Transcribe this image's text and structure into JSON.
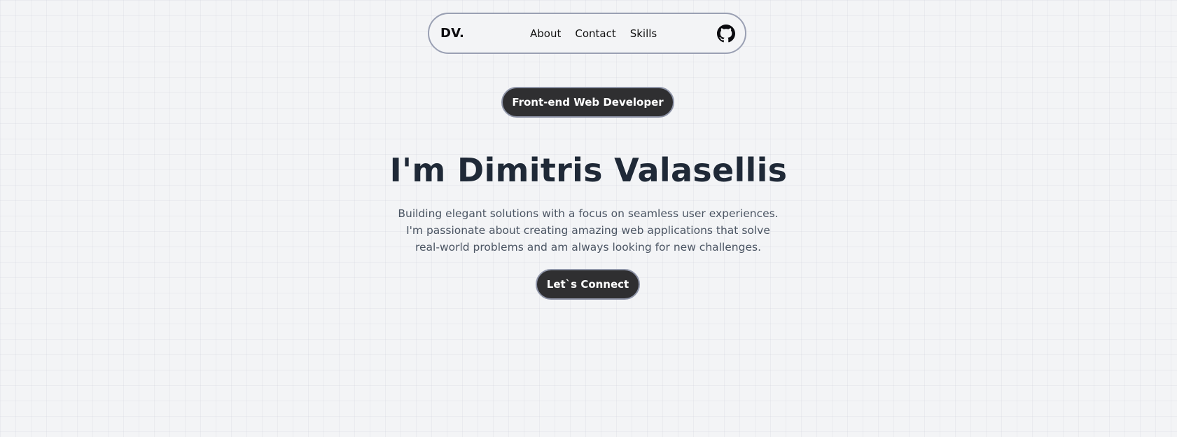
{
  "navbar": {
    "brand": "DV.",
    "links": [
      {
        "label": "About"
      },
      {
        "label": "Contact"
      },
      {
        "label": "Skills"
      }
    ],
    "github_icon": "github-icon"
  },
  "hero": {
    "badge": "Front-end Web Developer",
    "title": "I'm Dimitris Valasellis",
    "description_lines": [
      "Building elegant solutions with a focus on seamless user experiences.",
      "I'm passionate about creating amazing web applications that solve",
      "real-world problems and am always looking for new challenges."
    ],
    "cta_label": "Let`s Connect"
  },
  "colors": {
    "background": "#f3f4f6",
    "button_bg": "#2f2f31",
    "button_border": "#8f95a8",
    "title_text": "#1f2937",
    "body_text": "#4b5563",
    "nav_border": "#9aa0b3"
  }
}
